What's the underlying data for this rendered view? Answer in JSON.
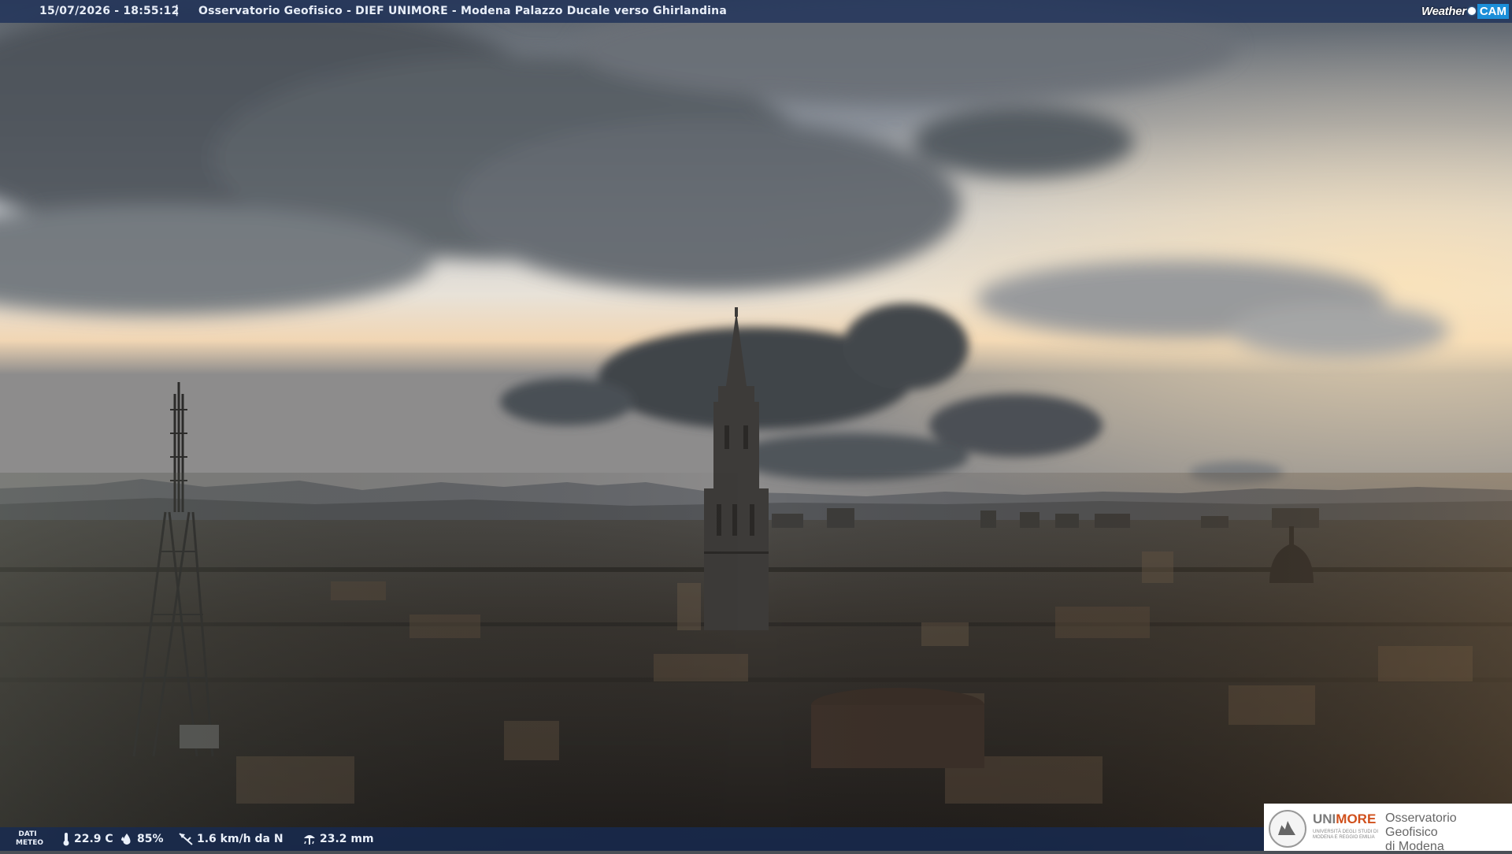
{
  "overlay": {
    "datetime": "15/07/2026 - 18:55:12",
    "separator": "|",
    "title": "Osservatorio Geofisico - DIEF UNIMORE - Modena Palazzo Ducale verso Ghirlandina",
    "logo": {
      "weather": "Weather",
      "cam": "CAM"
    }
  },
  "weather_bar": {
    "label": "DATI METEO",
    "temperature": "22.9 C",
    "humidity": "85%",
    "wind": "1.6 km/h da N",
    "rain": "23.2 mm"
  },
  "unimore_box": {
    "uni_prefix": "UNI",
    "uni_suffix": "MORE",
    "subtitle": "UNIVERSITÀ DEGLI STUDI DI MODENA E REGGIO EMILIA",
    "observatory_line1": "Osservatorio Geofisico",
    "observatory_line2": "di Modena"
  },
  "colors": {
    "bar": "#1c3058",
    "accent": "#d0501c",
    "logo_blue": "#1b8fd9"
  },
  "icons": [
    "thermometer-icon",
    "humidity-drop-icon",
    "wind-vane-icon",
    "rain-gauge-icon",
    "camera-dot-icon",
    "university-seal-icon"
  ]
}
